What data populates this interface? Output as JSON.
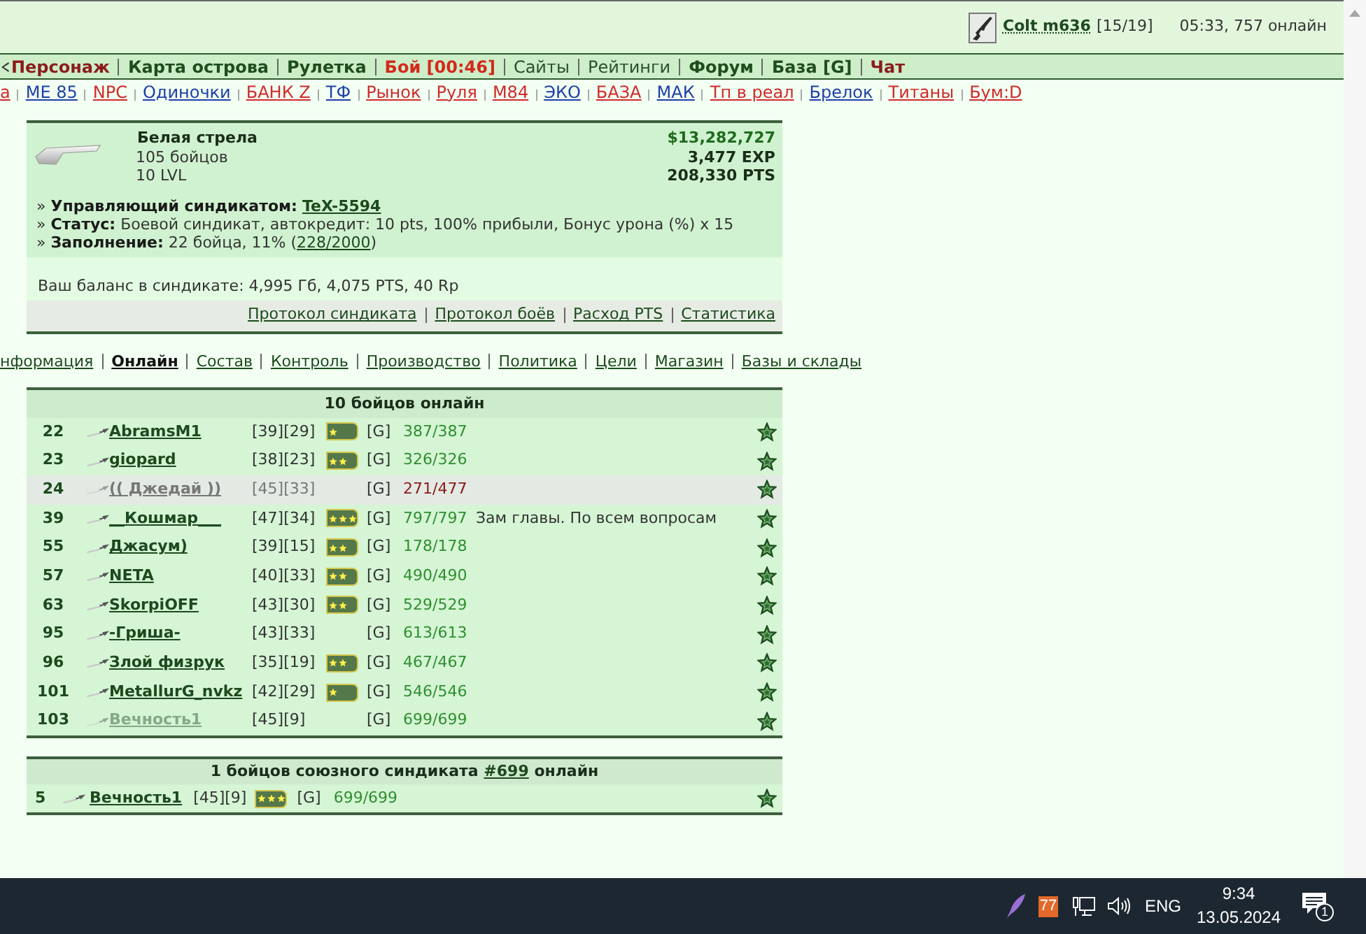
{
  "top_bar": {
    "player": "Colt m636",
    "counter": "[15/19]",
    "status": "05:33, 757 онлайн"
  },
  "main_nav": [
    {
      "label": "Персонаж",
      "color": "#8b1c1c",
      "bold": true
    },
    {
      "label": "Карта острова",
      "color": "#1e4d1e",
      "bold": true
    },
    {
      "label": "Рулетка",
      "color": "#1e4d1e",
      "bold": true
    },
    {
      "label": "Бой [00:46]",
      "color": "#d4281c",
      "bold": true
    },
    {
      "label": "Сайты",
      "color": "#2e4f2e",
      "bold": false
    },
    {
      "label": "Рейтинги",
      "color": "#2e4f2e",
      "bold": false
    },
    {
      "label": "Форум",
      "color": "#1e4d1e",
      "bold": true
    },
    {
      "label": "База [G]",
      "color": "#1e4d1e",
      "bold": true
    },
    {
      "label": "Чат",
      "color": "#8b1c1c",
      "bold": true
    }
  ],
  "quick_links": [
    {
      "label": "а",
      "color": "#d02b2b"
    },
    {
      "label": "МЕ 85",
      "color": "#1f3fa8"
    },
    {
      "label": "NPC",
      "color": "#d02b2b"
    },
    {
      "label": "Одиночки",
      "color": "#1f3fa8"
    },
    {
      "label": "БАНК Z",
      "color": "#d02b2b"
    },
    {
      "label": "ТФ",
      "color": "#1f3fa8"
    },
    {
      "label": "Рынок",
      "color": "#d02b2b"
    },
    {
      "label": "Руля",
      "color": "#d02b2b"
    },
    {
      "label": "М84",
      "color": "#d02b2b"
    },
    {
      "label": "ЭКО",
      "color": "#1f3fa8"
    },
    {
      "label": "БАЗА",
      "color": "#d02b2b"
    },
    {
      "label": "МАК",
      "color": "#1f3fa8"
    },
    {
      "label": "Тп в реал",
      "color": "#d02b2b"
    },
    {
      "label": "Брелок",
      "color": "#1f3fa8"
    },
    {
      "label": "Титаны",
      "color": "#d02b2b"
    },
    {
      "label": "Бум:D",
      "color": "#d02b2b"
    }
  ],
  "syndicate": {
    "name": "Белая стрела",
    "members": "105 бойцов",
    "level": "10 LVL",
    "money": "$13,282,727",
    "exp": "3,477 EXP",
    "pts": "208,330 PTS",
    "info": [
      {
        "marker": "»",
        "label": "Управляющий синдикатом:",
        "segments": [
          {
            "kind": "bold_link",
            "text": "TeX-5594"
          }
        ]
      },
      {
        "marker": "»",
        "label": "Статус:",
        "segments": [
          {
            "kind": "text",
            "text": "Боевой синдикат, автокредит: 10 pts, 100% прибыли, Бонус урона (%) x 15"
          }
        ]
      },
      {
        "marker": "»",
        "label": "Заполнение:",
        "segments": [
          {
            "kind": "text",
            "text": "22 бойца, 11% ("
          },
          {
            "kind": "link",
            "text": "228/2000"
          },
          {
            "kind": "text",
            "text": ")"
          }
        ]
      }
    ],
    "balance": "Ваш баланс в синдикате: 4,995 Гб, 4,075 PTS, 40 Rp",
    "links": [
      "Протокол синдиката",
      "Протокол боёв",
      "Расход PTS",
      "Статистика"
    ]
  },
  "tabs": [
    {
      "label": "нформация",
      "selected": false
    },
    {
      "label": "Онлайн",
      "selected": true
    },
    {
      "label": "Состав",
      "selected": false
    },
    {
      "label": "Контроль",
      "selected": false
    },
    {
      "label": "Производство",
      "selected": false
    },
    {
      "label": "Политика",
      "selected": false
    },
    {
      "label": "Цели",
      "selected": false
    },
    {
      "label": "Магазин",
      "selected": false
    },
    {
      "label": "Базы и склады",
      "selected": false
    }
  ],
  "online": {
    "title": "10 бойцов онлайн",
    "rows": [
      {
        "number": "22",
        "name": "AbramsM1",
        "levels": "[39][29]",
        "insignia": [
          {
            "kind": "star"
          }
        ],
        "clan": "[G]",
        "hp": "387/387",
        "hp_full": true,
        "kind": "normal"
      },
      {
        "number": "23",
        "name": "giopard",
        "levels": "[38][23]",
        "insignia": [
          {
            "kind": "star"
          },
          {
            "kind": "star"
          }
        ],
        "clan": "[G]",
        "hp": "326/326",
        "hp_full": true,
        "kind": "normal"
      },
      {
        "number": "24",
        "name": "(( Джедай ))",
        "levels": "[45][33]",
        "clan": "[G]",
        "hp": "271/477",
        "hp_full": false,
        "kind": "dimmed"
      },
      {
        "number": "39",
        "name": "__Кошмар___",
        "levels": "[47][34]",
        "insignia": [
          {
            "kind": "star"
          },
          {
            "kind": "star"
          },
          {
            "kind": "star"
          }
        ],
        "clan": "[G]",
        "hp": "797/797",
        "hp_full": true,
        "note": "Зам главы. По всем вопросам",
        "kind": "normal"
      },
      {
        "number": "55",
        "name": "Джасум)",
        "levels": "[39][15]",
        "insignia": [
          {
            "kind": "star"
          },
          {
            "kind": "star"
          }
        ],
        "clan": "[G]",
        "hp": "178/178",
        "hp_full": true,
        "kind": "normal"
      },
      {
        "number": "57",
        "name": "NETA",
        "levels": "[40][33]",
        "insignia": [
          {
            "kind": "star"
          },
          {
            "kind": "star"
          }
        ],
        "clan": "[G]",
        "hp": "490/490",
        "hp_full": true,
        "kind": "normal"
      },
      {
        "number": "63",
        "name": "SkorpiOFF",
        "levels": "[43][30]",
        "insignia": [
          {
            "kind": "star"
          },
          {
            "kind": "star"
          }
        ],
        "clan": "[G]",
        "hp": "529/529",
        "hp_full": true,
        "kind": "normal"
      },
      {
        "number": "95",
        "name": "-Гриша-",
        "levels": "[43][33]",
        "clan": "[G]",
        "hp": "613/613",
        "hp_full": true,
        "kind": "normal"
      },
      {
        "number": "96",
        "name": "Злой физрук",
        "levels": "[35][19]",
        "insignia": [
          {
            "kind": "star"
          },
          {
            "kind": "star"
          }
        ],
        "clan": "[G]",
        "hp": "467/467",
        "hp_full": true,
        "kind": "normal"
      },
      {
        "number": "101",
        "name": "MetallurG_nvkz",
        "levels": "[42][29]",
        "insignia": [
          {
            "kind": "star"
          }
        ],
        "clan": "[G]",
        "hp": "546/546",
        "hp_full": true,
        "kind": "normal"
      },
      {
        "number": "103",
        "name": "Вечность1",
        "levels": "[45][9]",
        "clan": "[G]",
        "hp": "699/699",
        "hp_full": true,
        "kind": "faded"
      }
    ]
  },
  "allied": {
    "title_before": "1 бойцов союзного синдиката",
    "link": "#699",
    "title_after": "онлайн",
    "rows": [
      {
        "number": "5",
        "name": "Вечность1",
        "levels": "[45][9]",
        "insignia": [
          {
            "kind": "star"
          },
          {
            "kind": "star"
          },
          {
            "kind": "star"
          }
        ],
        "clan": "[G]",
        "hp": "699/699",
        "hp_full": true,
        "kind": "normal"
      }
    ]
  },
  "taskbar": {
    "tray_counter": "77",
    "language": "ENG",
    "time": "9:34",
    "date": "13.05.2024",
    "notifications": "1"
  }
}
